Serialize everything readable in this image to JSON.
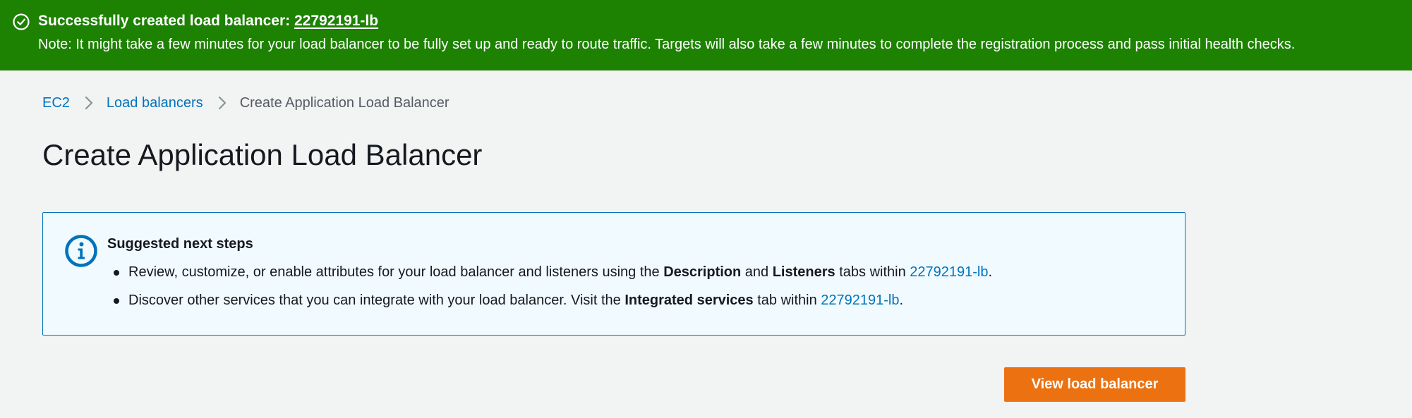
{
  "flash": {
    "status": "success",
    "color": "#1d8102",
    "icon": "check-circle-icon",
    "title_prefix": "Successfully created load balancer: ",
    "title_link": "22792191-lb",
    "note": "Note: It might take a few minutes for your load balancer to be fully set up and ready to route traffic. Targets will also take a few minutes to complete the registration process and pass initial health checks."
  },
  "breadcrumb": {
    "items": [
      {
        "label": "EC2"
      },
      {
        "label": "Load balancers"
      },
      {
        "label": "Create Application Load Balancer"
      }
    ],
    "separator_icon": "chevron-right-icon"
  },
  "page": {
    "title": "Create Application Load Balancer"
  },
  "info": {
    "icon": "info-icon",
    "heading": "Suggested next steps",
    "steps": [
      {
        "text_1": "Review, customize, or enable attributes for your load balancer and listeners using the ",
        "bold_1": "Description",
        "text_2": " and ",
        "bold_2": "Listeners",
        "text_3": " tabs within ",
        "link": "22792191-lb",
        "text_4": "."
      },
      {
        "text_1": "Discover other services that you can integrate with your load balancer. Visit the ",
        "bold_1": "Integrated services",
        "text_2": " tab within ",
        "link": "22792191-lb",
        "text_3": "."
      }
    ]
  },
  "actions": {
    "view_load_balancer": "View load balancer",
    "primary_color": "#ec7211"
  },
  "colors": {
    "background": "#f2f3f3",
    "link": "#0073bb",
    "info_background": "#f1faff"
  }
}
